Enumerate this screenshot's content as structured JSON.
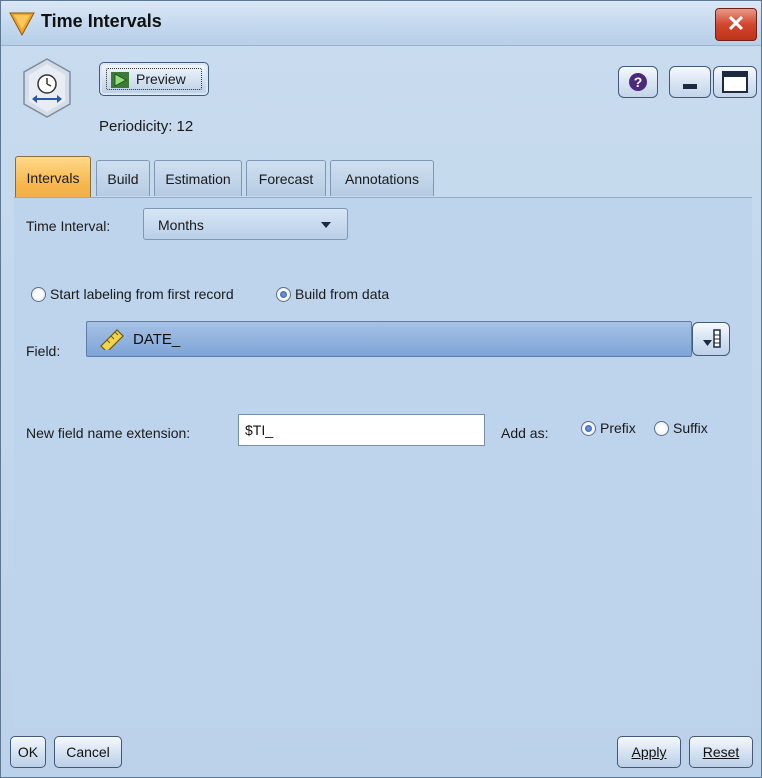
{
  "window": {
    "title": "Time Intervals",
    "close_glyph": "✕"
  },
  "header": {
    "preview_label": "Preview",
    "periodicity": "Periodicity: 12"
  },
  "tabs": [
    {
      "label": "Intervals",
      "active": true
    },
    {
      "label": "Build",
      "active": false
    },
    {
      "label": "Estimation",
      "active": false
    },
    {
      "label": "Forecast",
      "active": false
    },
    {
      "label": "Annotations",
      "active": false
    }
  ],
  "intervals": {
    "time_interval_label": "Time Interval:",
    "time_interval_value": "Months",
    "radio_start_label": "Start labeling from first record",
    "radio_build_label": "Build from data",
    "selected_labeling": "Build from data",
    "field_label": "Field:",
    "field_value": "DATE_",
    "extension_label": "New field name extension:",
    "extension_value": "$TI_",
    "add_as_label": "Add as:",
    "prefix_label": "Prefix",
    "suffix_label": "Suffix",
    "selected_add_as": "Prefix"
  },
  "footer": {
    "ok_label": "OK",
    "cancel_label": "Cancel",
    "apply_label": "Apply",
    "reset_label": "Reset"
  },
  "colors": {
    "panel": "#bed4ec",
    "active_tab": "#f7b54a",
    "field_box": "#8cb0dd",
    "close_button": "#d2462d"
  },
  "icons": [
    "node-time-intervals-icon",
    "play-icon",
    "help-icon",
    "minimize-icon",
    "maximize-icon",
    "close-icon",
    "dropdown-arrow-icon",
    "ruler-icon",
    "field-picker-icon"
  ]
}
